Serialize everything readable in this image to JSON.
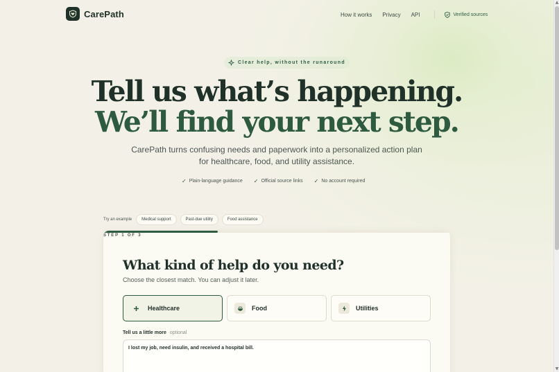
{
  "brand": {
    "name": "CarePath"
  },
  "nav": {
    "items": [
      "How it works",
      "Privacy",
      "API"
    ],
    "verified_label": "Verified sources"
  },
  "hero": {
    "eyebrow": "Clear help, without the runaround",
    "line1": "Tell us what’s happening.",
    "line2": "We’ll find your next step.",
    "subtitle_line1": "CarePath turns confusing needs and paperwork into a personalized action plan",
    "subtitle_line2": "for healthcare, food, and utility assistance.",
    "features": [
      "Plain-language guidance",
      "Official source links",
      "No account required"
    ]
  },
  "examples": {
    "label": "Try an example",
    "chips": [
      "Medical support",
      "Past-due utility",
      "Food assistance"
    ]
  },
  "wizard": {
    "step_label": "STEP 1 OF 3",
    "progress": 0.33,
    "title": "What kind of help do you need?",
    "subtitle": "Choose the closest match. You can adjust it later.",
    "options": [
      {
        "label": "Healthcare",
        "icon": "plus-icon",
        "selected": true
      },
      {
        "label": "Food",
        "icon": "bowl-icon",
        "selected": false
      },
      {
        "label": "Utilities",
        "icon": "bolt-icon",
        "selected": false
      }
    ],
    "details_label": "Tell us a little more",
    "details_optional": "optional",
    "details_value": "I lost my job, need insulin, and received a hospital bill."
  },
  "colors": {
    "brand_dark": "#1f3128",
    "accent_green": "#2e5a40",
    "background": "#f3f1e7"
  }
}
